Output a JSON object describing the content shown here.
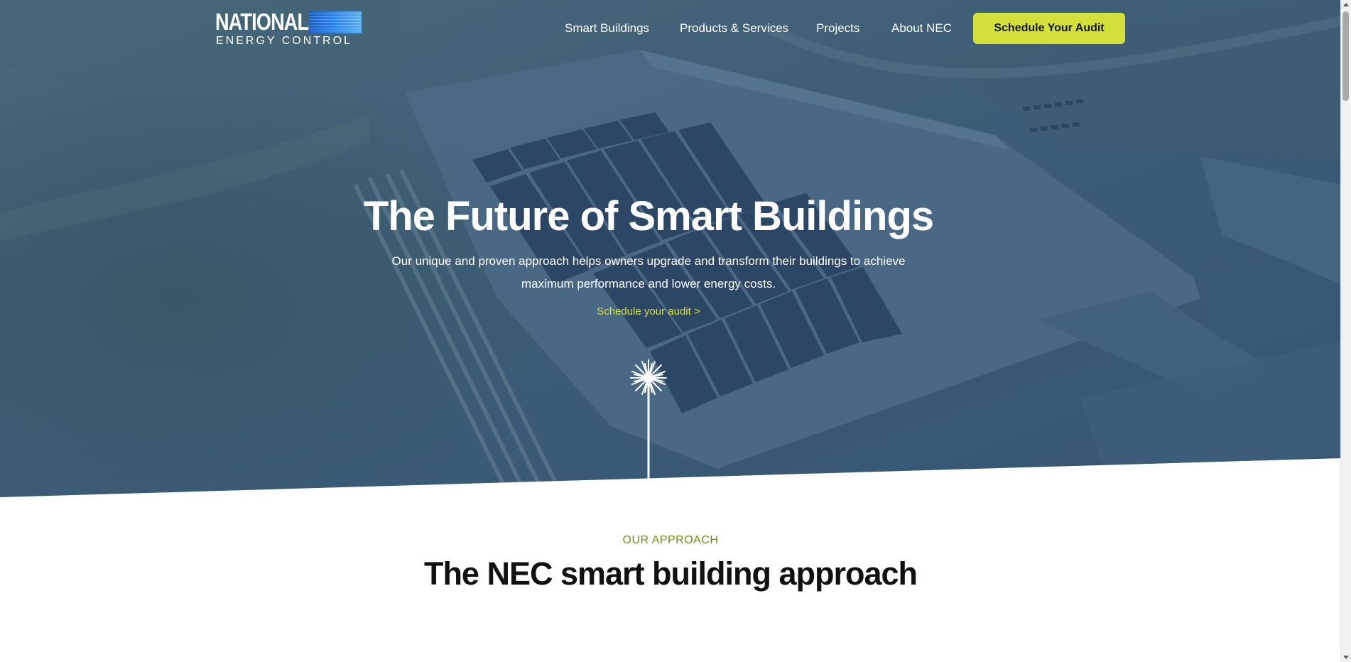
{
  "header": {
    "logo": {
      "line1": "NATIONAL",
      "line2": "ENERGY CONTROL"
    },
    "nav": [
      {
        "label": "Smart Buildings"
      },
      {
        "label": "Products & Services"
      },
      {
        "label": "Projects"
      },
      {
        "label": "About NEC"
      }
    ],
    "cta_label": "Schedule Your Audit"
  },
  "hero": {
    "title": "The Future of Smart Buildings",
    "subtitle": "Our unique and proven approach helps owners upgrade and transform their buildings to achieve maximum performance and lower energy costs.",
    "link_label": "Schedule your audit >"
  },
  "approach": {
    "eyebrow": "OUR APPROACH",
    "title": "The NEC smart building approach"
  },
  "colors": {
    "accent": "#d4e03a",
    "hero_overlay": "#3c5c78",
    "eyebrow": "#7a8a1e",
    "heading": "#111111"
  },
  "icons": {
    "burst": "starburst-icon"
  }
}
